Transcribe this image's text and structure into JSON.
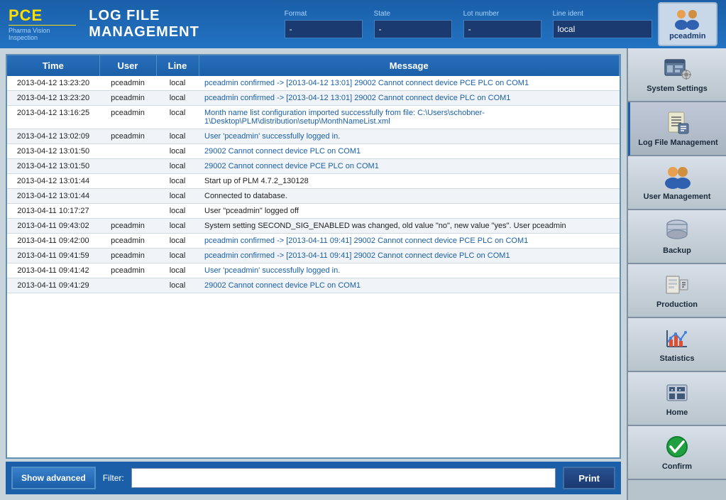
{
  "header": {
    "logo": "PCE",
    "logo_sub": "Pharma Vision Inspection",
    "title": "LOG FILE MANAGEMENT",
    "fields": {
      "format_label": "Format",
      "format_value": "-",
      "state_label": "State",
      "state_value": "-",
      "lot_label": "Lot number",
      "lot_value": "-",
      "line_label": "Line ident",
      "line_value": "local"
    },
    "user": "pceadmin"
  },
  "table": {
    "columns": [
      "Time",
      "User",
      "Line",
      "Message"
    ],
    "rows": [
      {
        "time": "2013-04-12 13:23:20",
        "user": "pceadmin",
        "line": "local",
        "message": "pceadmin confirmed -> [2013-04-12 13:01] 29002 Cannot connect device PCE PLC on COM1",
        "msg_color": "blue"
      },
      {
        "time": "2013-04-12 13:23:20",
        "user": "pceadmin",
        "line": "local",
        "message": "pceadmin confirmed -> [2013-04-12 13:01] 29002 Cannot connect device PLC on COM1",
        "msg_color": "blue"
      },
      {
        "time": "2013-04-12 13:16:25",
        "user": "pceadmin",
        "line": "local",
        "message": "Month name list configuration imported successfully from file: C:\\Users\\schobner-1\\Desktop\\PLM\\distribution\\setup\\MonthNameList.xml",
        "msg_color": "blue"
      },
      {
        "time": "2013-04-12 13:02:09",
        "user": "pceadmin",
        "line": "local",
        "message": "User 'pceadmin' successfully logged in.",
        "msg_color": "blue"
      },
      {
        "time": "2013-04-12 13:01:50",
        "user": "",
        "line": "local",
        "message": "29002 Cannot connect device PLC on COM1",
        "msg_color": "blue"
      },
      {
        "time": "2013-04-12 13:01:50",
        "user": "",
        "line": "local",
        "message": "29002 Cannot connect device PCE PLC on COM1",
        "msg_color": "blue"
      },
      {
        "time": "2013-04-12 13:01:44",
        "user": "",
        "line": "local",
        "message": "Start up of PLM 4.7.2_130128",
        "msg_color": "black"
      },
      {
        "time": "2013-04-12 13:01:44",
        "user": "",
        "line": "local",
        "message": "Connected to database.",
        "msg_color": "black"
      },
      {
        "time": "2013-04-11 10:17:27",
        "user": "",
        "line": "local",
        "message": "User \"pceadmin\" logged off",
        "msg_color": "black"
      },
      {
        "time": "2013-04-11 09:43:02",
        "user": "pceadmin",
        "line": "local",
        "message": "System setting SECOND_SIG_ENABLED was changed, old value \"no\", new value \"yes\". User pceadmin",
        "msg_color": "black"
      },
      {
        "time": "2013-04-11 09:42:00",
        "user": "pceadmin",
        "line": "local",
        "message": "pceadmin confirmed -> [2013-04-11 09:41] 29002 Cannot connect device PCE PLC on COM1",
        "msg_color": "blue"
      },
      {
        "time": "2013-04-11 09:41:59",
        "user": "pceadmin",
        "line": "local",
        "message": "pceadmin confirmed -> [2013-04-11 09:41] 29002 Cannot connect device PLC on COM1",
        "msg_color": "blue"
      },
      {
        "time": "2013-04-11 09:41:42",
        "user": "pceadmin",
        "line": "local",
        "message": "User 'pceadmin' successfully logged in.",
        "msg_color": "blue"
      },
      {
        "time": "2013-04-11 09:41:29",
        "user": "",
        "line": "local",
        "message": "29002 Cannot connect device PLC on COM1",
        "msg_color": "blue"
      }
    ]
  },
  "bottom": {
    "show_advanced_label": "Show advanced",
    "filter_label": "Filter:",
    "filter_placeholder": "",
    "print_label": "Print"
  },
  "sidebar": {
    "items": [
      {
        "id": "system-settings",
        "label": "System Settings"
      },
      {
        "id": "log-file-management",
        "label": "Log File Management"
      },
      {
        "id": "user-management",
        "label": "User Management"
      },
      {
        "id": "backup",
        "label": "Backup"
      },
      {
        "id": "production",
        "label": "Production"
      },
      {
        "id": "statistics",
        "label": "Statistics"
      },
      {
        "id": "home",
        "label": "Home"
      },
      {
        "id": "confirm",
        "label": "Confirm"
      }
    ]
  }
}
